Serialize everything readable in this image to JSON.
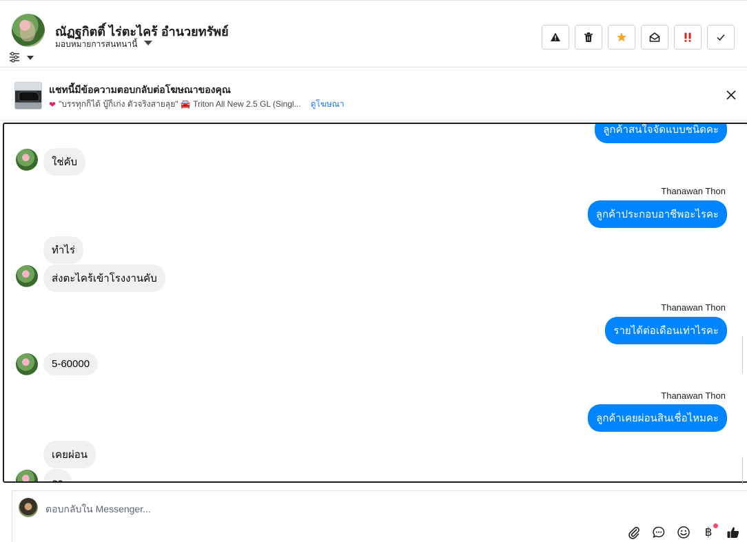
{
  "header": {
    "contact_name": "ณัฏฐกิตติ์ ไร่ตะไคร้ อำนวยทรัพย์",
    "assign_label": "มอบหมายการสนทนานี้",
    "actions": [
      {
        "name": "report-button",
        "icon": "warning-icon"
      },
      {
        "name": "delete-button",
        "icon": "trash-icon"
      },
      {
        "name": "star-button",
        "icon": "star-icon",
        "color": "#f5a623"
      },
      {
        "name": "mark-unread-button",
        "icon": "envelope-open-icon"
      },
      {
        "name": "spam-button",
        "icon": "double-exclamation-icon",
        "color": "#e02020"
      },
      {
        "name": "mark-done-button",
        "icon": "check-icon"
      }
    ]
  },
  "ad_banner": {
    "title": "แชทนี้มีข้อความตอบกลับต่อโฆษณาของคุณ",
    "subtitle": "\"บรรทุกก็ได้ บู๊ก็เก่ง ตัวจริงสายลุย\" 🚘 Triton All New 2.5 GL (Singl...",
    "link": "ดูโฆษณา"
  },
  "messages": {
    "top_partial": "ลูกค้าสนใจจัดแบบชนิดคะ",
    "m1": "ใช่คับ",
    "sender": "Thanawan Thon",
    "m2": "ลูกค้าประกอบอาชีพอะไรคะ",
    "m3": "ทำไร่",
    "m4": "ส่งตะไคร้เข้าโรงงานคับ",
    "m5": "รายได้ต่อเดือนเท่าไรคะ",
    "m6": "5-60000",
    "m7": "ลูกค้าเคยผ่อนสินเชื่อไหมคะ",
    "m8": "เคยผ่อน",
    "m9": "รถ"
  },
  "composer": {
    "placeholder": "ตอบกลับใน Messenger...",
    "tools": [
      "paperclip-icon",
      "chat-bubble-icon",
      "emoji-icon",
      "baht-icon",
      "thumbs-up-icon"
    ],
    "baht_symbol": "฿"
  },
  "colors": {
    "outgoing_bubble": "#0084ff",
    "incoming_bubble": "#f0f0f0",
    "link": "#1877f2"
  }
}
